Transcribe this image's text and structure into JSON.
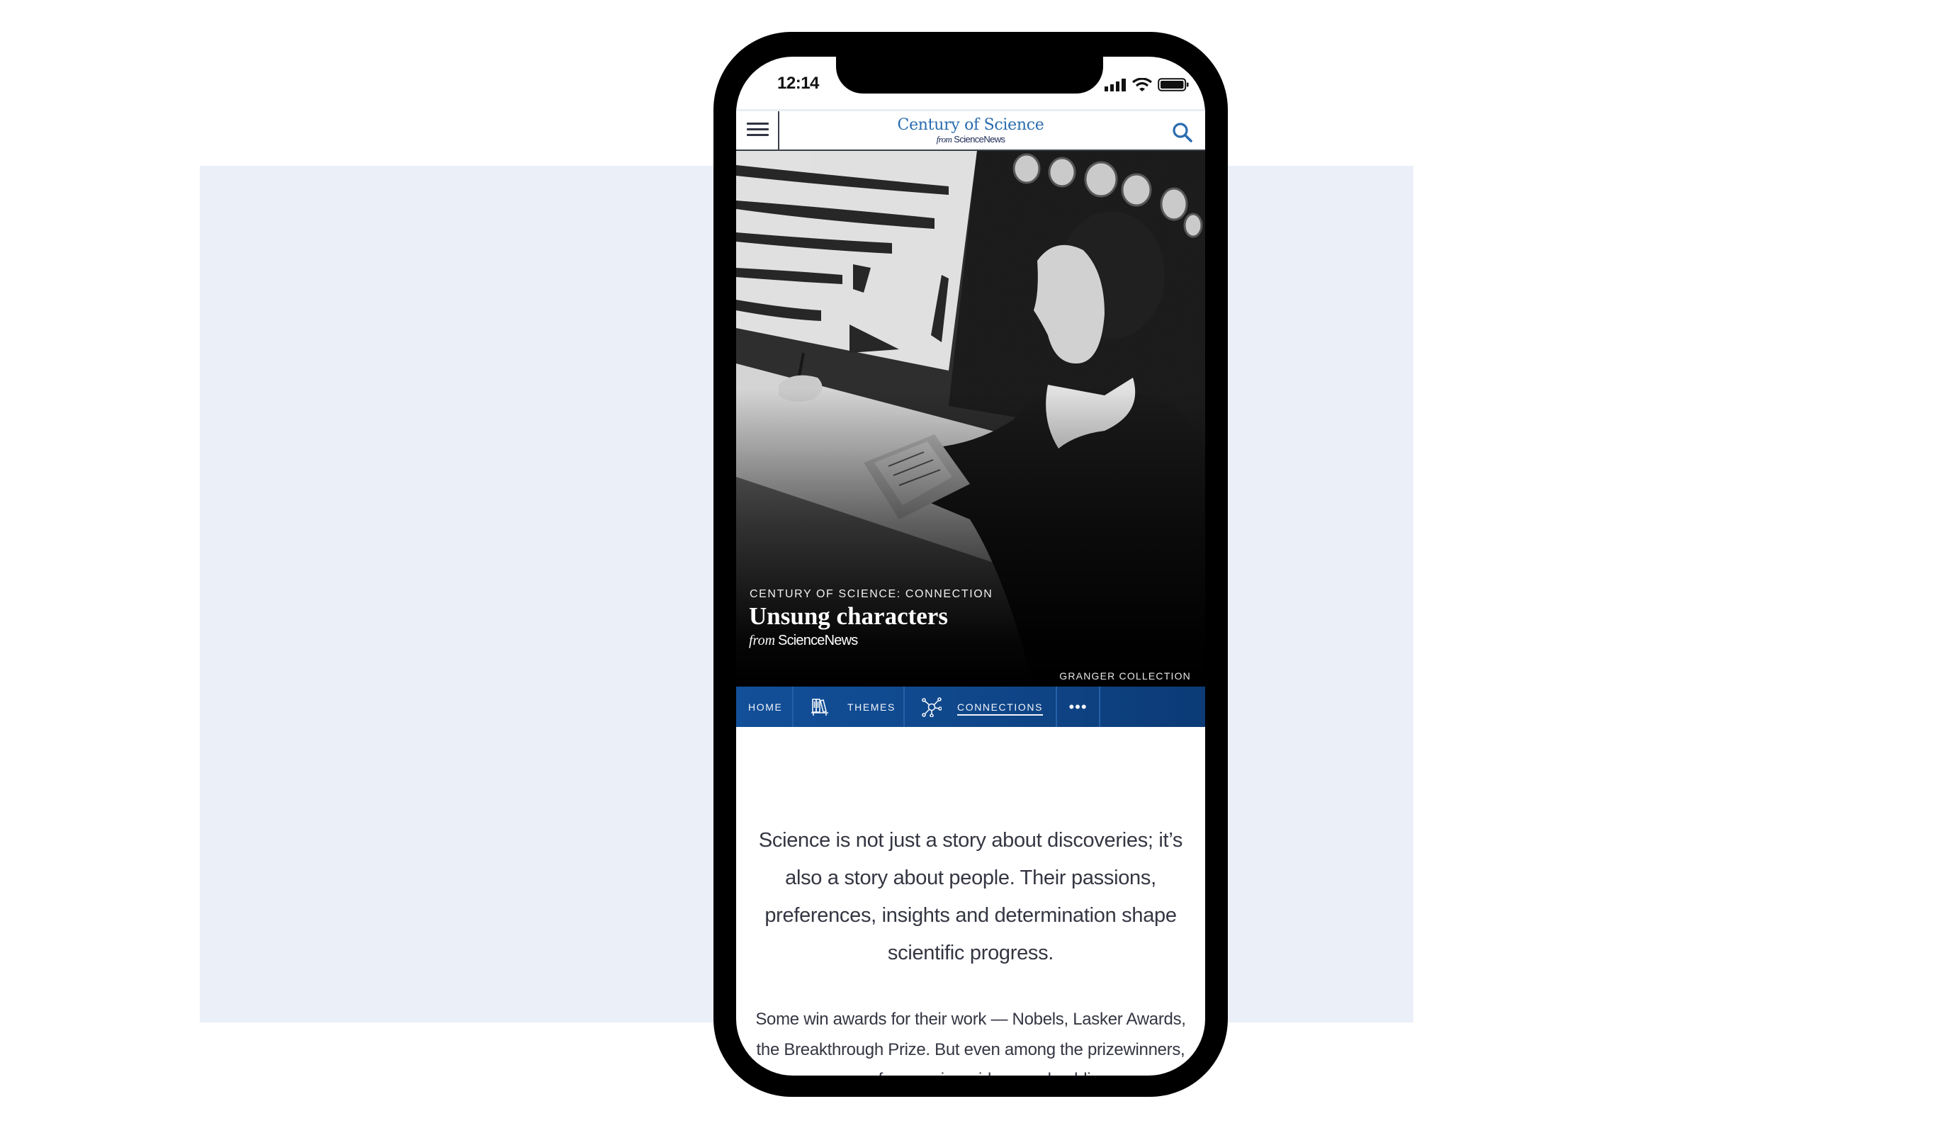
{
  "status_bar": {
    "time": "12:14",
    "icons": [
      "cellular-signal-icon",
      "wifi-icon",
      "battery-icon"
    ]
  },
  "header": {
    "menu_icon": "hamburger-menu-icon",
    "logo_title": "Century of Science",
    "logo_from": "from",
    "logo_brand": "ScienceNews",
    "search_icon": "search-icon",
    "accent_color": "#2a6caf"
  },
  "hero": {
    "kicker": "CENTURY OF SCIENCE: CONNECTION",
    "title": "Unsung characters",
    "from": "from",
    "brand": "ScienceNews",
    "credit": "GRANGER COLLECTION",
    "image_description": "Black-and-white photo of a woman writing at a desk in front of charts and rolled papers"
  },
  "nav": {
    "items": [
      {
        "label": "HOME",
        "icon": null,
        "active": false
      },
      {
        "label": "THEMES",
        "icon": "bookshelf-icon",
        "active": false
      },
      {
        "label": "CONNECTIONS",
        "icon": "network-icon",
        "active": true
      }
    ],
    "more_label": "•••",
    "background_color": "#124f98"
  },
  "article": {
    "lead": "Science is not just a story about discoveries; it’s also a story about people. Their passions, preferences, insights and determination shape scientific progress.",
    "paragraph": "Some win awards for their work — Nobels, Lasker Awards, the Breakthrough Prize. But even among the prizewinners, very few receive widespread public"
  }
}
